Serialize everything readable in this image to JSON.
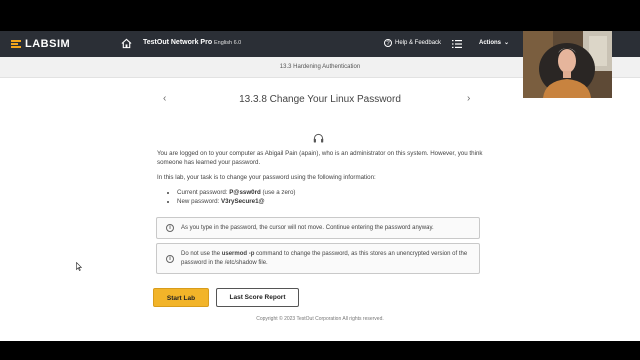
{
  "app": {
    "logo_text": "LABSIM",
    "product": "TestOut Network Pro",
    "version": "English 6.0",
    "help_label": "Help & Feedback",
    "actions_label": "Actions"
  },
  "section": "13.3 Hardening Authentication",
  "page_title": "13.3.8 Change Your Linux Password",
  "intro": {
    "p1": "You are logged on to your computer as Abigail Pain (apain), who is an administrator on this system. However, you think someone has learned your password.",
    "p2": "In this lab, your task is to change your password using the following information:"
  },
  "bullets": [
    {
      "label": "Current password: ",
      "value": "P@ssw0rd",
      "suffix": " (use a zero)"
    },
    {
      "label": "New password: ",
      "value": "V3rySecure1@",
      "suffix": ""
    }
  ],
  "notes": {
    "n1": "As you type in the password, the cursor will not move. Continue entering the password anyway.",
    "n2_pre": "Do not use the ",
    "n2_cmd": "usermod -p",
    "n2_post": " command to change the password, as this stores an unencrypted version of the password in the /etc/shadow file."
  },
  "buttons": {
    "start": "Start Lab",
    "score": "Last Score Report"
  },
  "copyright": "Copyright © 2023 TestOut Corporation  All rights reserved.",
  "colors": {
    "topbar": "#2b2f36",
    "accent": "#f2b429",
    "logo_accent": "#f2a51c"
  },
  "icons": {
    "home": "home-icon",
    "help": "help-circle-icon",
    "list": "list-icon",
    "info": "info-icon",
    "headphones": "headphones-icon",
    "prev": "chevron-left-icon",
    "next": "chevron-right-icon"
  }
}
